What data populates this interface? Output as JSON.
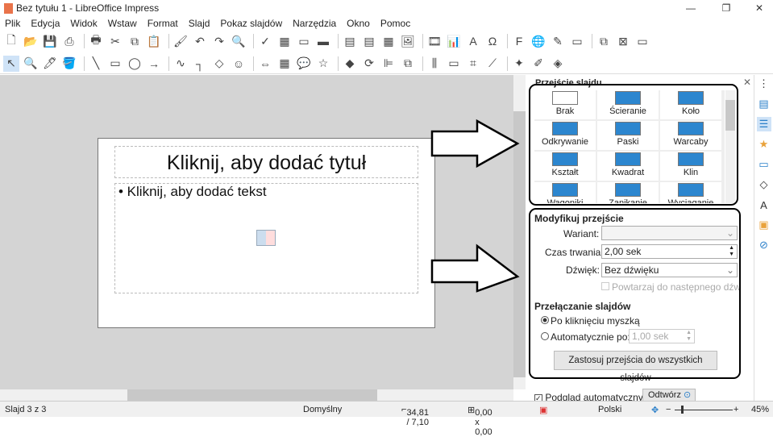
{
  "window": {
    "title": "Bez tytułu 1 - LibreOffice Impress",
    "minimize": "—",
    "restore": "❐",
    "close": "✕"
  },
  "menu": [
    "Plik",
    "Edycja",
    "Widok",
    "Wstaw",
    "Format",
    "Slajd",
    "Pokaz slajdów",
    "Narzędzia",
    "Okno",
    "Pomoc"
  ],
  "toolbar1": [
    {
      "name": "new-icon",
      "g": "🗋"
    },
    {
      "name": "open-icon",
      "g": "📂"
    },
    {
      "name": "save-icon",
      "g": "💾"
    },
    {
      "name": "export-pdf-icon",
      "g": "⎙"
    },
    {
      "name": "print-icon",
      "g": "🖶"
    },
    {
      "name": "cut-icon",
      "g": "✂"
    },
    {
      "name": "copy-icon",
      "g": "⧉"
    },
    {
      "name": "paste-icon",
      "g": "📋"
    },
    {
      "name": "clone-formatting-icon",
      "g": "🖌"
    },
    {
      "name": "undo-icon",
      "g": "↶"
    },
    {
      "name": "redo-icon",
      "g": "↷"
    },
    {
      "name": "find-replace-icon",
      "g": "🔍"
    },
    {
      "name": "spelling-icon",
      "g": "✓"
    },
    {
      "name": "grid-icon",
      "g": "▦"
    },
    {
      "name": "display-views-icon",
      "g": "▭"
    },
    {
      "name": "master-slide-icon",
      "g": "▬"
    },
    {
      "name": "start-first-icon",
      "g": "▤"
    },
    {
      "name": "start-current-icon",
      "g": "▤"
    },
    {
      "name": "table-icon",
      "g": "▦"
    },
    {
      "name": "image-icon",
      "g": "🖼"
    },
    {
      "name": "media-icon",
      "g": "🎞"
    },
    {
      "name": "chart-icon",
      "g": "📊"
    },
    {
      "name": "textbox-icon",
      "g": "A"
    },
    {
      "name": "special-char-icon",
      "g": "Ω"
    },
    {
      "name": "fontwork-icon",
      "g": "F"
    },
    {
      "name": "hyperlink-icon",
      "g": "🌐"
    },
    {
      "name": "show-draw-icon",
      "g": "✎"
    },
    {
      "name": "new-slide-icon",
      "g": "▭"
    },
    {
      "name": "duplicate-slide-icon",
      "g": "⧉"
    },
    {
      "name": "delete-slide-icon",
      "g": "⊠"
    },
    {
      "name": "slide-layout-icon",
      "g": "▭"
    }
  ],
  "toolbar2": [
    {
      "name": "select-icon",
      "g": "↖"
    },
    {
      "name": "zoom-pan-icon",
      "g": "🔍"
    },
    {
      "name": "line-color-icon",
      "g": "🖊"
    },
    {
      "name": "fill-color-icon",
      "g": "🪣"
    },
    {
      "name": "line-icon",
      "g": "╲"
    },
    {
      "name": "rectangle-icon",
      "g": "▭"
    },
    {
      "name": "ellipse-icon",
      "g": "◯"
    },
    {
      "name": "arrow-line-icon",
      "g": "→"
    },
    {
      "name": "curve-icon",
      "g": "∿"
    },
    {
      "name": "connector-icon",
      "g": "┐"
    },
    {
      "name": "basic-shapes-icon",
      "g": "◇"
    },
    {
      "name": "symbol-shapes-icon",
      "g": "☺"
    },
    {
      "name": "block-arrows-icon",
      "g": "⇔"
    },
    {
      "name": "flowchart-icon",
      "g": "▦"
    },
    {
      "name": "callout-icon",
      "g": "💬"
    },
    {
      "name": "stars-icon",
      "g": "☆"
    },
    {
      "name": "3d-objects-icon",
      "g": "◆"
    },
    {
      "name": "rotate-icon",
      "g": "⟳"
    },
    {
      "name": "align-icon",
      "g": "⊫"
    },
    {
      "name": "arrange-icon",
      "g": "⧉"
    },
    {
      "name": "distribute-icon",
      "g": "⫼"
    },
    {
      "name": "shadow-icon",
      "g": "▭"
    },
    {
      "name": "crop-icon",
      "g": "⌗"
    },
    {
      "name": "filter-icon",
      "g": "⟋"
    },
    {
      "name": "points-icon",
      "g": "✦"
    },
    {
      "name": "glue-icon",
      "g": "✐"
    },
    {
      "name": "toggle-extrusion-icon",
      "g": "◈"
    }
  ],
  "slide": {
    "title_placeholder": "Kliknij, aby dodać tytuł",
    "body_placeholder": "• Kliknij, aby dodać tekst"
  },
  "sidebar": {
    "panel_title": "Przejście slajdu",
    "transitions": [
      "Brak",
      "Ścieranie",
      "Koło",
      "Odkrywanie",
      "Paski",
      "Warcaby",
      "Kształt",
      "Kwadrat",
      "Klin",
      "Wagoniki",
      "Zanikanie",
      "Wyciąganie"
    ],
    "modify": {
      "heading": "Modyfikuj przejście",
      "variant_label": "Wariant:",
      "variant_value": "",
      "duration_label": "Czas trwania:",
      "duration_value": "2,00 sek",
      "sound_label": "Dźwięk:",
      "sound_value": "Bez dźwięku",
      "loop_label": "Powtarzaj do następnego dźwięku",
      "loop_checked": false
    },
    "advance": {
      "heading": "Przełączanie slajdów",
      "on_click_label": "Po kliknięciu myszką",
      "on_click_selected": true,
      "auto_label": "Automatycznie po:",
      "auto_value": "1,00 sek",
      "apply_all": "Zastosuj przejścia do wszystkich slajdów"
    },
    "autopreview_label": "Podgląd automatyczny",
    "autopreview_checked": true,
    "play_label": "Odtwórz"
  },
  "status": {
    "slide": "Slajd 3 z 3",
    "master": "Domyślny",
    "position": "34,81 / 7,10",
    "size": "0,00 x 0,00",
    "language": "Polski",
    "zoom": "45%",
    "zoom_level": 45
  }
}
